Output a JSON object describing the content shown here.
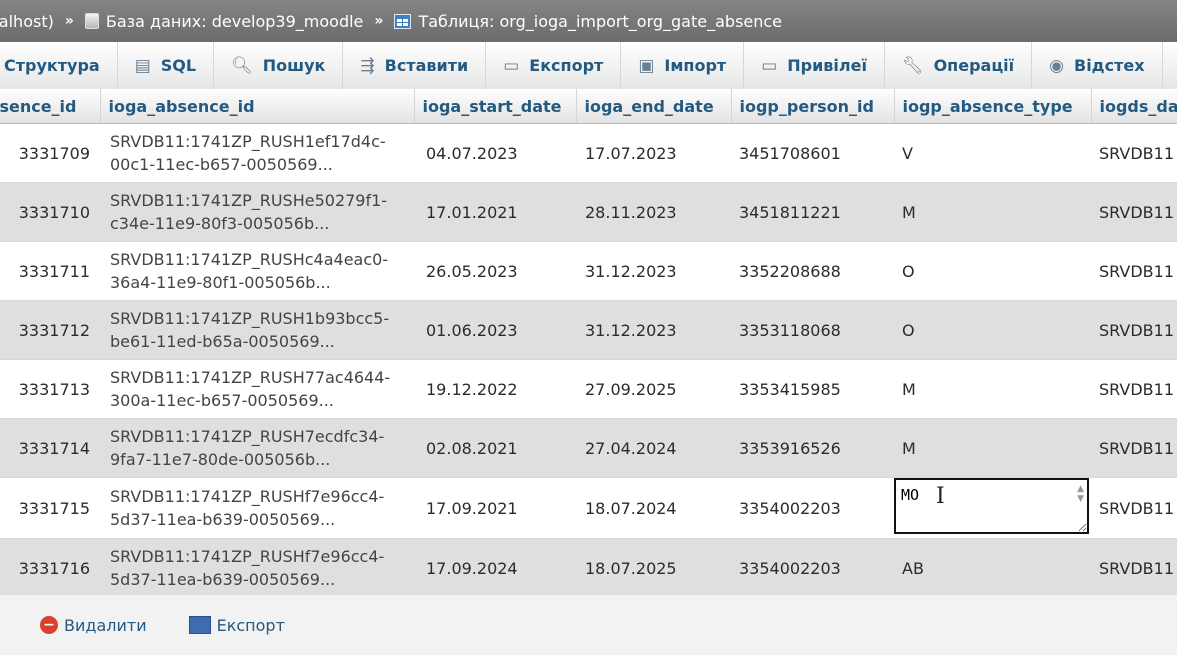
{
  "breadcrumb": {
    "server": "calhost)",
    "separator": "»",
    "database_label": "База даних: develop39_moodle",
    "table_label": "Таблиця: org_ioga_import_org_gate_absence"
  },
  "tabs": [
    {
      "label": "Структура",
      "icon": ""
    },
    {
      "label": "SQL",
      "icon": "sql-icon"
    },
    {
      "label": "Пошук",
      "icon": "search-icon"
    },
    {
      "label": "Вставити",
      "icon": "insert-icon"
    },
    {
      "label": "Експорт",
      "icon": "export-icon"
    },
    {
      "label": "Імпорт",
      "icon": "import-icon"
    },
    {
      "label": "Привілеї",
      "icon": "privileges-icon"
    },
    {
      "label": "Операції",
      "icon": "wrench-icon"
    },
    {
      "label": "Відстех",
      "icon": "eye-icon"
    }
  ],
  "table": {
    "columns": [
      "bsence_id",
      "ioga_absence_id",
      "ioga_start_date",
      "ioga_end_date",
      "iogp_person_id",
      "iogp_absence_type",
      "iogds_da"
    ],
    "rows": [
      {
        "id": "3331709",
        "absence_line1": "SRVDB11:1741ZP_RUSH1ef17d4c-",
        "absence_line2": "00c1-11ec-b657-0050569...",
        "start": "04.07.2023",
        "end": "17.07.2023",
        "person": "3451708601",
        "type": "V",
        "ds": "SRVDB11"
      },
      {
        "id": "3331710",
        "absence_line1": "SRVDB11:1741ZP_RUSHe50279f1-",
        "absence_line2": "c34e-11e9-80f3-005056b...",
        "start": "17.01.2021",
        "end": "28.11.2023",
        "person": "3451811221",
        "type": "M",
        "ds": "SRVDB11"
      },
      {
        "id": "3331711",
        "absence_line1": "SRVDB11:1741ZP_RUSHc4a4eac0-",
        "absence_line2": "36a4-11e9-80f1-005056b...",
        "start": "26.05.2023",
        "end": "31.12.2023",
        "person": "3352208688",
        "type": "O",
        "ds": "SRVDB11"
      },
      {
        "id": "3331712",
        "absence_line1": "SRVDB11:1741ZP_RUSH1b93bcc5-",
        "absence_line2": "be61-11ed-b65a-0050569...",
        "start": "01.06.2023",
        "end": "31.12.2023",
        "person": "3353118068",
        "type": "O",
        "ds": "SRVDB11"
      },
      {
        "id": "3331713",
        "absence_line1": "SRVDB11:1741ZP_RUSH77ac4644-",
        "absence_line2": "300a-11ec-b657-0050569...",
        "start": "19.12.2022",
        "end": "27.09.2025",
        "person": "3353415985",
        "type": "M",
        "ds": "SRVDB11"
      },
      {
        "id": "3331714",
        "absence_line1": "SRVDB11:1741ZP_RUSH7ecdfc34-",
        "absence_line2": "9fa7-11e7-80de-005056b...",
        "start": "02.08.2021",
        "end": "27.04.2024",
        "person": "3353916526",
        "type": "M",
        "ds": "SRVDB11"
      },
      {
        "id": "3331715",
        "absence_line1": "SRVDB11:1741ZP_RUSHf7e96cc4-",
        "absence_line2": "5d37-11ea-b639-0050569...",
        "start": "17.09.2021",
        "end": "18.07.2024",
        "person": "3354002203",
        "type": "MO",
        "ds": "SRVDB11",
        "editing": true
      },
      {
        "id": "3331716",
        "absence_line1": "SRVDB11:1741ZP_RUSHf7e96cc4-",
        "absence_line2": "5d37-11ea-b639-0050569...",
        "start": "17.09.2024",
        "end": "18.07.2025",
        "person": "3354002203",
        "type": "AB",
        "ds": "SRVDB11"
      }
    ]
  },
  "footer": {
    "delete_label": "Видалити",
    "export_label": "Експорт"
  },
  "colors": {
    "link": "#235a81",
    "breadcrumb_bg": "#6b6b6b",
    "row_alt": "#dfdfdf"
  }
}
